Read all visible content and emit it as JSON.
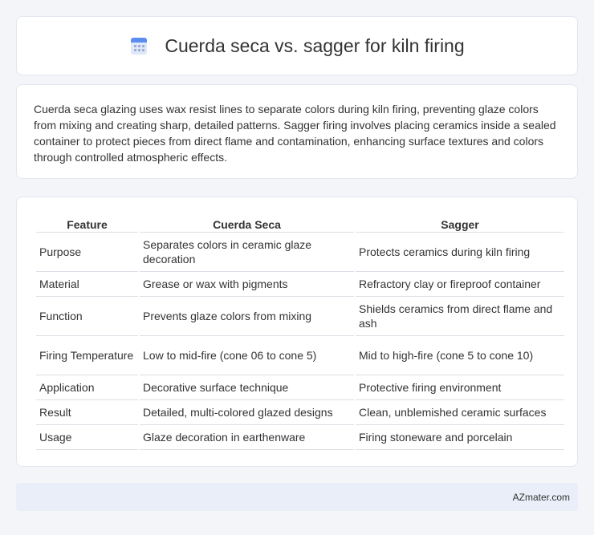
{
  "header": {
    "title": "Cuerda seca vs. sagger for kiln firing",
    "icon": "calendar-icon"
  },
  "intro": {
    "text": "Cuerda seca glazing uses wax resist lines to separate colors during kiln firing, preventing glaze colors from mixing and creating sharp, detailed patterns. Sagger firing involves placing ceramics inside a sealed container to protect pieces from direct flame and contamination, enhancing surface textures and colors through controlled atmospheric effects."
  },
  "table": {
    "headers": [
      "Feature",
      "Cuerda Seca",
      "Sagger"
    ],
    "rows": [
      [
        "Purpose",
        "Separates colors in ceramic glaze decoration",
        "Protects ceramics during kiln firing"
      ],
      [
        "Material",
        "Grease or wax with pigments",
        "Refractory clay or fireproof container"
      ],
      [
        "Function",
        "Prevents glaze colors from mixing",
        "Shields ceramics from direct flame and ash"
      ],
      [
        "Firing Temperature",
        "Low to mid-fire (cone 06 to cone 5)",
        "Mid to high-fire (cone 5 to cone 10)"
      ],
      [
        "Application",
        "Decorative surface technique",
        "Protective firing environment"
      ],
      [
        "Result",
        "Detailed, multi-colored glazed designs",
        "Clean, unblemished ceramic surfaces"
      ],
      [
        "Usage",
        "Glaze decoration in earthenware",
        "Firing stoneware and porcelain"
      ]
    ]
  },
  "footer": {
    "brand": "AZmater.com"
  }
}
